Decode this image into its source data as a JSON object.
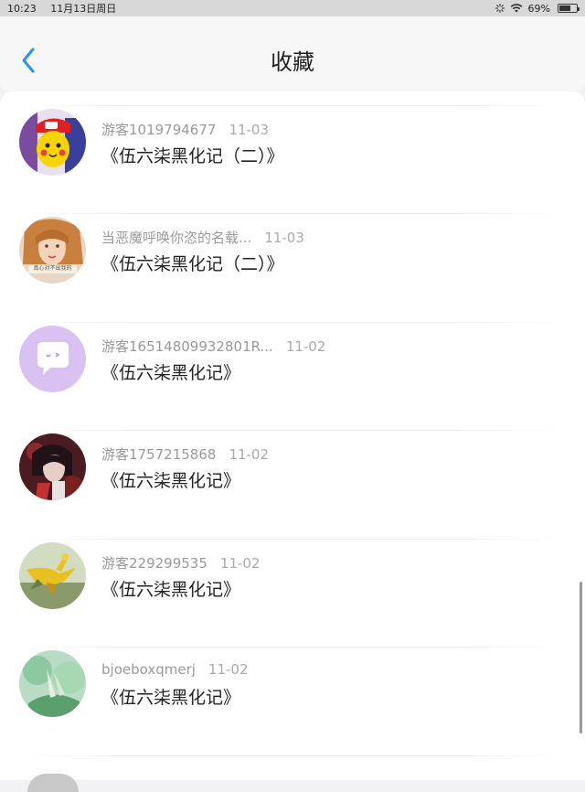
{
  "status_bar": {
    "time": "10:23",
    "date": "11月13日周日",
    "battery": "69%",
    "battery_level": 0.69
  },
  "header": {
    "title": "收藏",
    "back_icon": "chevron-left-icon",
    "accent_color": "#2a94e8"
  },
  "favorites": [
    {
      "user": "游客1019794677",
      "date": "11-03",
      "title": "《伍六柒黑化记（二）》"
    },
    {
      "user": "当恶魔呼唤你恣的名载...",
      "date": "11-03",
      "title": "《伍六柒黑化记（二）》",
      "avatar_caption": "真心对不出我的"
    },
    {
      "user": "游客16514809932801R...",
      "date": "11-02",
      "title": "《伍六柒黑化记》"
    },
    {
      "user": "游客1757215868",
      "date": "11-02",
      "title": "《伍六柒黑化记》"
    },
    {
      "user": "游客229299535",
      "date": "11-02",
      "title": "《伍六柒黑化记》"
    },
    {
      "user": "bjoeboxqmerj",
      "date": "11-02",
      "title": "《伍六柒黑化记》"
    }
  ]
}
